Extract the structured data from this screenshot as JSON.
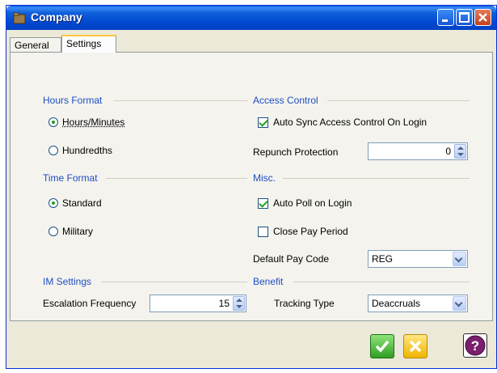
{
  "window": {
    "title": "Company",
    "title_icon": "folder-icon"
  },
  "titlebar_buttons": [
    "minimize-icon",
    "maximize-icon",
    "close-icon"
  ],
  "tabs": [
    {
      "label": "General",
      "active": false
    },
    {
      "label": "Settings",
      "active": true
    }
  ],
  "hours_format": {
    "title": "Hours Format",
    "options": [
      {
        "label": "Hours/Minutes",
        "selected": true
      },
      {
        "label": "Hundredths",
        "selected": false
      }
    ]
  },
  "time_format": {
    "title": "Time Format",
    "options": [
      {
        "label": "Standard",
        "selected": true
      },
      {
        "label": "Military",
        "selected": false
      }
    ]
  },
  "im_settings": {
    "title": "IM Settings",
    "escalation_label": "Escalation Frequency",
    "escalation_value": "15"
  },
  "access_control": {
    "title": "Access Control",
    "auto_sync_label": "Auto Sync Access Control On Login",
    "auto_sync_checked": true,
    "repunch_label": "Repunch Protection",
    "repunch_value": "0"
  },
  "misc": {
    "title": "Misc.",
    "auto_poll_label": "Auto Poll on Login",
    "auto_poll_checked": true,
    "close_pay_label": "Close Pay Period",
    "close_pay_checked": false,
    "default_pay_label": "Default Pay Code",
    "default_pay_value": "REG"
  },
  "benefit": {
    "title": "Benefit",
    "tracking_label": "Tracking Type",
    "tracking_value": "Deaccruals"
  },
  "footer_buttons": [
    "ok-icon",
    "cancel-icon",
    "help-icon"
  ],
  "colors": {
    "title_bar": "#0047d1",
    "group_title": "#1f4ec3",
    "ok": "#2f9f22",
    "cancel": "#f0b400",
    "help": "#7a1f6e"
  }
}
